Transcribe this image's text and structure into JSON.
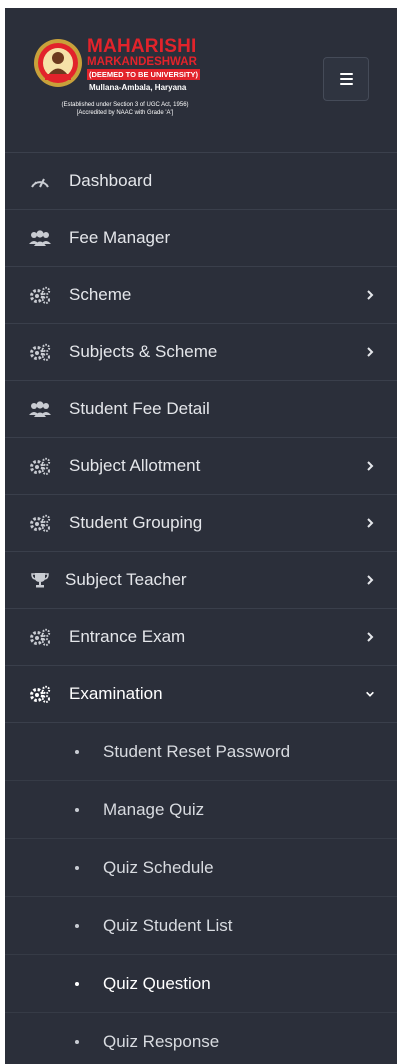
{
  "brand": {
    "title": "MAHARISHI",
    "subtitle": "MARKANDESHWAR",
    "deemed": "(DEEMED TO BE UNIVERSITY)",
    "place": "Mullana-Ambala, Haryana",
    "established": "(Established under Section 3 of UGC Act, 1956)",
    "accredited": "[Accredited by NAAC with Grade 'A']"
  },
  "colors": {
    "sidebar_bg": "#2b2f3a",
    "brand_red": "#e2232b",
    "text": "#e4e6ea"
  },
  "menu_toggle": {
    "icon": "hamburger-icon"
  },
  "nav": {
    "items": [
      {
        "label": "Dashboard",
        "icon": "speedometer-icon",
        "has_submenu": false
      },
      {
        "label": "Fee Manager",
        "icon": "users-icon",
        "has_submenu": false
      },
      {
        "label": "Scheme",
        "icon": "cogs-icon",
        "has_submenu": true
      },
      {
        "label": "Subjects & Scheme",
        "icon": "cogs-icon",
        "has_submenu": true
      },
      {
        "label": "Student Fee Detail",
        "icon": "users-icon",
        "has_submenu": false
      },
      {
        "label": "Subject Allotment",
        "icon": "cogs-icon",
        "has_submenu": true
      },
      {
        "label": "Student Grouping",
        "icon": "cogs-icon",
        "has_submenu": true
      },
      {
        "label": "Subject Teacher",
        "icon": "trophy-icon",
        "has_submenu": true
      },
      {
        "label": "Entrance Exam",
        "icon": "cogs-icon",
        "has_submenu": true
      },
      {
        "label": "Examination",
        "icon": "cogs-icon",
        "has_submenu": true,
        "expanded": true
      }
    ],
    "examination_submenu": [
      {
        "label": "Student Reset Password"
      },
      {
        "label": "Manage Quiz"
      },
      {
        "label": "Quiz Schedule"
      },
      {
        "label": "Quiz Student List"
      },
      {
        "label": "Quiz Question",
        "current": true
      },
      {
        "label": "Quiz Response"
      }
    ]
  }
}
